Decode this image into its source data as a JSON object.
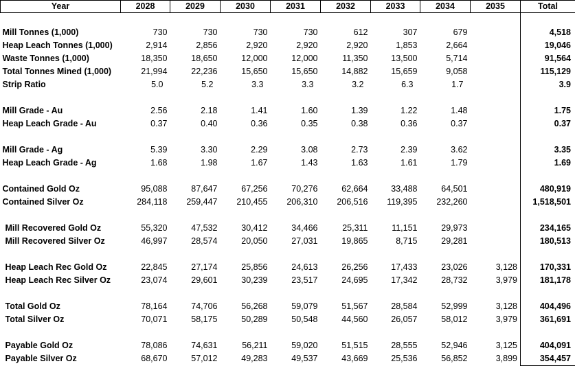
{
  "header": {
    "year": "Year",
    "years": [
      "2028",
      "2029",
      "2030",
      "2031",
      "2032",
      "2033",
      "2034",
      "2035"
    ],
    "total": "Total"
  },
  "rows": [
    {
      "type": "spacer"
    },
    {
      "label": "Mill Tonnes (1,000)",
      "values": [
        "730",
        "730",
        "730",
        "730",
        "612",
        "307",
        "679",
        ""
      ],
      "total": "4,518"
    },
    {
      "label": "Heap Leach Tonnes (1,000)",
      "values": [
        "2,914",
        "2,856",
        "2,920",
        "2,920",
        "2,920",
        "1,853",
        "2,664",
        ""
      ],
      "total": "19,046"
    },
    {
      "label": "Waste Tonnes (1,000)",
      "values": [
        "18,350",
        "18,650",
        "12,000",
        "12,000",
        "11,350",
        "13,500",
        "5,714",
        ""
      ],
      "total": "91,564"
    },
    {
      "label": "Total Tonnes Mined (1,000)",
      "values": [
        "21,994",
        "22,236",
        "15,650",
        "15,650",
        "14,882",
        "15,659",
        "9,058",
        ""
      ],
      "total": "115,129"
    },
    {
      "label": "Strip Ratio",
      "shift": true,
      "values": [
        "5.0",
        "5.2",
        "3.3",
        "3.3",
        "3.2",
        "6.3",
        "1.7",
        ""
      ],
      "total": "3.9"
    },
    {
      "type": "spacer"
    },
    {
      "label": "Mill Grade - Au",
      "values": [
        "2.56",
        "2.18",
        "1.41",
        "1.60",
        "1.39",
        "1.22",
        "1.48",
        ""
      ],
      "total": "1.75"
    },
    {
      "label": "Heap Leach Grade - Au",
      "values": [
        "0.37",
        "0.40",
        "0.36",
        "0.35",
        "0.38",
        "0.36",
        "0.37",
        ""
      ],
      "total": "0.37"
    },
    {
      "type": "spacer"
    },
    {
      "label": "Mill Grade - Ag",
      "values": [
        "5.39",
        "3.30",
        "2.29",
        "3.08",
        "2.73",
        "2.39",
        "3.62",
        ""
      ],
      "total": "3.35"
    },
    {
      "label": "Heap Leach Grade - Ag",
      "values": [
        "1.68",
        "1.98",
        "1.67",
        "1.43",
        "1.63",
        "1.61",
        "1.79",
        ""
      ],
      "total": "1.69"
    },
    {
      "type": "spacer"
    },
    {
      "label": "Contained Gold Oz",
      "values": [
        "95,088",
        "87,647",
        "67,256",
        "70,276",
        "62,664",
        "33,488",
        "64,501",
        ""
      ],
      "total": "480,919"
    },
    {
      "label": "Contained Silver Oz",
      "values": [
        "284,118",
        "259,447",
        "210,455",
        "206,310",
        "206,516",
        "119,395",
        "232,260",
        ""
      ],
      "total": "1,518,501"
    },
    {
      "type": "spacer"
    },
    {
      "label": "Mill Recovered Gold Oz",
      "indent": true,
      "values": [
        "55,320",
        "47,532",
        "30,412",
        "34,466",
        "25,311",
        "11,151",
        "29,973",
        ""
      ],
      "total": "234,165"
    },
    {
      "label": "Mill Recovered Silver Oz",
      "indent": true,
      "values": [
        "46,997",
        "28,574",
        "20,050",
        "27,031",
        "19,865",
        "8,715",
        "29,281",
        ""
      ],
      "total": "180,513"
    },
    {
      "type": "spacer"
    },
    {
      "label": "Heap Leach Rec Gold Oz",
      "indent": true,
      "values": [
        "22,845",
        "27,174",
        "25,856",
        "24,613",
        "26,256",
        "17,433",
        "23,026",
        "3,128"
      ],
      "total": "170,331"
    },
    {
      "label": "Heap Leach Rec Silver Oz",
      "indent": true,
      "values": [
        "23,074",
        "29,601",
        "30,239",
        "23,517",
        "24,695",
        "17,342",
        "28,732",
        "3,979"
      ],
      "total": "181,178"
    },
    {
      "type": "spacer"
    },
    {
      "label": "Total Gold Oz",
      "indent": true,
      "values": [
        "78,164",
        "74,706",
        "56,268",
        "59,079",
        "51,567",
        "28,584",
        "52,999",
        "3,128"
      ],
      "total": "404,496"
    },
    {
      "label": "Total Silver Oz",
      "indent": true,
      "values": [
        "70,071",
        "58,175",
        "50,289",
        "50,548",
        "44,560",
        "26,057",
        "58,012",
        "3,979"
      ],
      "total": "361,691"
    },
    {
      "type": "spacer"
    },
    {
      "label": "Payable Gold Oz",
      "indent": true,
      "values": [
        "78,086",
        "74,631",
        "56,211",
        "59,020",
        "51,515",
        "28,555",
        "52,946",
        "3,125"
      ],
      "total": "404,091"
    },
    {
      "label": "Payable Silver Oz",
      "indent": true,
      "values": [
        "68,670",
        "57,012",
        "49,283",
        "49,537",
        "43,669",
        "25,536",
        "56,852",
        "3,899"
      ],
      "total": "354,457"
    }
  ]
}
